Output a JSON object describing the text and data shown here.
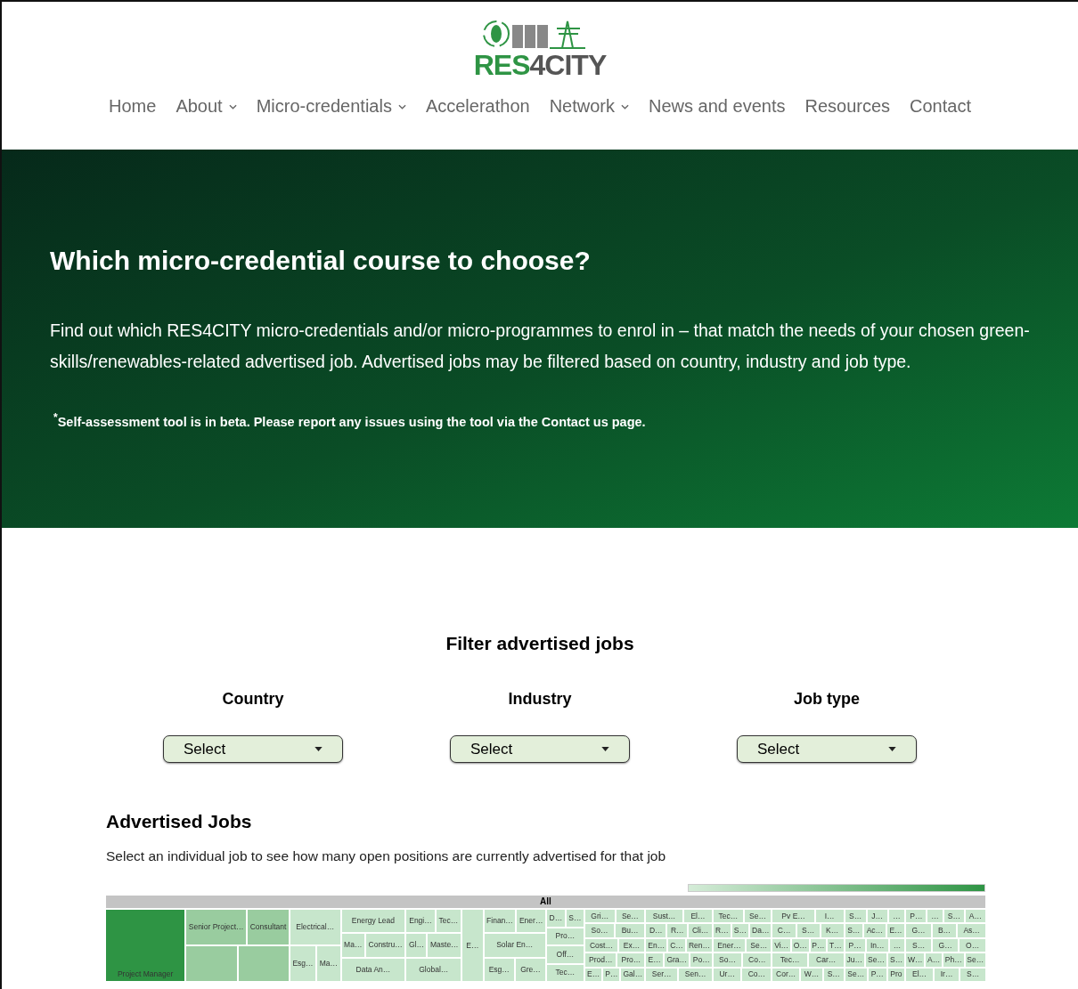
{
  "logo": {
    "text_left": "RES",
    "text_digit": "4",
    "text_right": "CITY"
  },
  "nav": [
    {
      "label": "Home",
      "dropdown": false
    },
    {
      "label": "About",
      "dropdown": true
    },
    {
      "label": "Micro-credentials",
      "dropdown": true
    },
    {
      "label": "Accelerathon",
      "dropdown": false
    },
    {
      "label": "Network",
      "dropdown": true
    },
    {
      "label": "News and events",
      "dropdown": false
    },
    {
      "label": "Resources",
      "dropdown": false
    },
    {
      "label": "Contact",
      "dropdown": false
    }
  ],
  "hero": {
    "title": "Which micro-credential course to choose?",
    "text": "Find out which RES4CITY micro-credentials and/or micro-programmes to enrol in – that match the needs of your chosen green-skills/renewables-related advertised job. Advertised jobs may be filtered based on country, industry and job type.",
    "note": "$^{*}$Self-assessment tool is in beta. Please report any issues using the tool via the Contact us page."
  },
  "filter": {
    "title": "Filter advertised jobs",
    "fields": [
      {
        "label": "Country",
        "placeholder": "Select"
      },
      {
        "label": "Industry",
        "placeholder": "Select"
      },
      {
        "label": "Job type",
        "placeholder": "Select"
      }
    ]
  },
  "jobs": {
    "title": "Advertised Jobs",
    "text": "Select an individual job to see how many open positions are currently advertised for that job",
    "treemap": {
      "root": "All",
      "columns": [
        {
          "rows": [
            [
              {
                "kind": "top",
                "label": "Project Manager",
                "color": "#2e9444"
              }
            ]
          ]
        },
        {
          "rows": [
            [
              {
                "label": "Senior Project…",
                "color": "#99cc9f"
              },
              {
                "label": "Consultant",
                "color": "#99cc9f"
              }
            ],
            [
              {
                "color": "#99cc9f"
              },
              {
                "color": "#99cc9f"
              }
            ]
          ]
        },
        {
          "rows": [
            [
              {
                "label": "Electrical…",
                "color": "#c7e6cc"
              }
            ],
            [
              {
                "label": "Esg…",
                "color": "#c7e6cc"
              },
              {
                "label": "Ma…",
                "color": "#c7e6cc"
              }
            ]
          ]
        },
        {
          "rows": [
            [
              {
                "label": "Energy Lead",
                "color": "#c7e6cc"
              }
            ],
            [
              {
                "label": "Ma…",
                "color": "#c7e6cc"
              },
              {
                "label": "Constru…",
                "color": "#c7e6cc"
              }
            ],
            [
              {
                "label": "Data An…",
                "color": "#c7e6cc"
              }
            ]
          ]
        },
        {
          "rows": [
            [
              {
                "label": "Engi…",
                "color": "#c7e6cc"
              },
              {
                "label": "Tec…",
                "color": "#c7e6cc"
              }
            ],
            [
              {
                "label": "Gl…",
                "color": "#c7e6cc"
              },
              {
                "label": "Maste…",
                "color": "#c7e6cc"
              }
            ],
            [
              {
                "label": "Global…",
                "color": "#c7e6cc"
              }
            ]
          ]
        },
        {
          "rows": [
            [
              {
                "label": "E…",
                "color": "#c7e6cc"
              }
            ]
          ]
        },
        {
          "rows": [
            [
              {
                "label": "Finan…",
                "color": "#c7e6cc"
              },
              {
                "label": "Ener…",
                "color": "#c7e6cc"
              }
            ],
            [
              {
                "label": "Solar En…",
                "color": "#c7e6cc"
              }
            ],
            [
              {
                "label": "Esg…",
                "color": "#c7e6cc"
              },
              {
                "label": "Gre…",
                "color": "#c7e6cc"
              }
            ]
          ]
        },
        {
          "rows": [
            [
              {
                "label": "D…",
                "color": "#c7e6cc"
              },
              {
                "label": "S…",
                "color": "#c7e6cc"
              }
            ],
            [
              {
                "label": "Pro…",
                "color": "#c7e6cc"
              }
            ],
            [
              {
                "label": "Off…",
                "color": "#c7e6cc"
              }
            ],
            [
              {
                "label": "Tec…",
                "color": "#c7e6cc"
              }
            ]
          ]
        },
        {
          "rows": [
            [
              {
                "label": "Gri…",
                "color": "#c7e6cc"
              },
              {
                "label": "Se…",
                "color": "#c7e6cc"
              }
            ],
            [
              {
                "label": "So…",
                "color": "#c7e6cc"
              },
              {
                "label": "Bu…",
                "color": "#c7e6cc"
              }
            ],
            [
              {
                "label": "Cost…",
                "color": "#c7e6cc"
              },
              {
                "label": "Ex…",
                "color": "#c7e6cc"
              }
            ],
            [
              {
                "label": "Prod…",
                "color": "#c7e6cc"
              },
              {
                "label": "Pro…",
                "color": "#c7e6cc"
              }
            ],
            [
              {
                "label": "E…",
                "color": "#c7e6cc"
              },
              {
                "label": "P…",
                "color": "#c7e6cc"
              },
              {
                "label": "Gal…",
                "color": "#c7e6cc"
              }
            ]
          ]
        },
        {
          "rows": [
            [
              {
                "label": "Sust…",
                "color": "#c7e6cc"
              },
              {
                "label": "El…",
                "color": "#c7e6cc"
              }
            ],
            [
              {
                "label": "D…",
                "color": "#c7e6cc"
              },
              {
                "label": "R…",
                "color": "#c7e6cc"
              },
              {
                "label": "Cli…",
                "color": "#c7e6cc"
              }
            ],
            [
              {
                "label": "En…",
                "color": "#c7e6cc"
              },
              {
                "label": "C…",
                "color": "#c7e6cc"
              },
              {
                "label": "Ren…",
                "color": "#c7e6cc"
              }
            ],
            [
              {
                "label": "E…",
                "color": "#c7e6cc"
              },
              {
                "label": "Gra…",
                "color": "#c7e6cc"
              },
              {
                "label": "Po…",
                "color": "#c7e6cc"
              }
            ],
            [
              {
                "label": "Ser…",
                "color": "#c7e6cc"
              },
              {
                "label": "Sen…",
                "color": "#c7e6cc"
              }
            ]
          ]
        },
        {
          "rows": [
            [
              {
                "label": "Tec…",
                "color": "#c7e6cc"
              },
              {
                "label": "Se…",
                "color": "#c7e6cc"
              }
            ],
            [
              {
                "label": "R…",
                "color": "#c7e6cc"
              },
              {
                "label": "S…",
                "color": "#c7e6cc"
              },
              {
                "label": "Da…",
                "color": "#c7e6cc"
              }
            ],
            [
              {
                "label": "Ener…",
                "color": "#c7e6cc"
              },
              {
                "label": "Se…",
                "color": "#c7e6cc"
              }
            ],
            [
              {
                "label": "So…",
                "color": "#c7e6cc"
              },
              {
                "label": "Co…",
                "color": "#c7e6cc"
              }
            ],
            [
              {
                "label": "Ur…",
                "color": "#c7e6cc"
              },
              {
                "label": "Co…",
                "color": "#c7e6cc"
              }
            ]
          ]
        },
        {
          "rows": [
            [
              {
                "label": "Pv E…",
                "color": "#c7e6cc"
              },
              {
                "label": "I…",
                "color": "#c7e6cc"
              }
            ],
            [
              {
                "label": "C…",
                "color": "#c7e6cc"
              },
              {
                "label": "S…",
                "color": "#c7e6cc"
              },
              {
                "label": "K…",
                "color": "#c7e6cc"
              }
            ],
            [
              {
                "label": "Vi…",
                "color": "#c7e6cc"
              },
              {
                "label": "O…",
                "color": "#c7e6cc"
              },
              {
                "label": "P…",
                "color": "#c7e6cc"
              },
              {
                "label": "T…",
                "color": "#c7e6cc"
              }
            ],
            [
              {
                "label": "Tec…",
                "color": "#c7e6cc"
              },
              {
                "label": "Car…",
                "color": "#c7e6cc"
              }
            ],
            [
              {
                "label": "Cor…",
                "color": "#c7e6cc"
              },
              {
                "label": "W…",
                "color": "#c7e6cc"
              },
              {
                "label": "S…",
                "color": "#c7e6cc"
              }
            ]
          ]
        },
        {
          "rows": [
            [
              {
                "label": "S…",
                "color": "#c7e6cc"
              },
              {
                "label": "J…",
                "color": "#c7e6cc"
              },
              {
                "label": "…",
                "color": "#c7e6cc"
              }
            ],
            [
              {
                "label": "S…",
                "color": "#c7e6cc"
              },
              {
                "label": "Ac…",
                "color": "#c7e6cc"
              },
              {
                "label": "E…",
                "color": "#c7e6cc"
              }
            ],
            [
              {
                "label": "P…",
                "color": "#c7e6cc"
              },
              {
                "label": "In…",
                "color": "#c7e6cc"
              },
              {
                "label": "…",
                "color": "#c7e6cc"
              }
            ],
            [
              {
                "label": "Ju…",
                "color": "#c7e6cc"
              },
              {
                "label": "Se…",
                "color": "#c7e6cc"
              },
              {
                "label": "S…",
                "color": "#c7e6cc"
              }
            ],
            [
              {
                "label": "Se…",
                "color": "#c7e6cc"
              },
              {
                "label": "P…",
                "color": "#c7e6cc"
              },
              {
                "label": "Pro",
                "color": "#c7e6cc"
              }
            ]
          ]
        },
        {
          "rows": [
            [
              {
                "label": "P…",
                "color": "#c7e6cc"
              },
              {
                "label": "…",
                "color": "#c7e6cc"
              },
              {
                "label": "S…",
                "color": "#c7e6cc"
              },
              {
                "label": "A…",
                "color": "#c7e6cc"
              }
            ],
            [
              {
                "label": "G…",
                "color": "#c7e6cc"
              },
              {
                "label": "B…",
                "color": "#c7e6cc"
              },
              {
                "label": "As…",
                "color": "#c7e6cc"
              }
            ],
            [
              {
                "label": "S…",
                "color": "#c7e6cc"
              },
              {
                "label": "G…",
                "color": "#c7e6cc"
              },
              {
                "label": "O…",
                "color": "#c7e6cc"
              }
            ],
            [
              {
                "label": "W…",
                "color": "#c7e6cc"
              },
              {
                "label": "A…",
                "color": "#c7e6cc"
              },
              {
                "label": "Ph…",
                "color": "#c7e6cc"
              },
              {
                "label": "Se…",
                "color": "#c7e6cc"
              }
            ],
            [
              {
                "label": "El…",
                "color": "#c7e6cc"
              },
              {
                "label": "Ir…",
                "color": "#c7e6cc"
              },
              {
                "label": "S…",
                "color": "#c7e6cc"
              }
            ]
          ]
        }
      ]
    }
  }
}
